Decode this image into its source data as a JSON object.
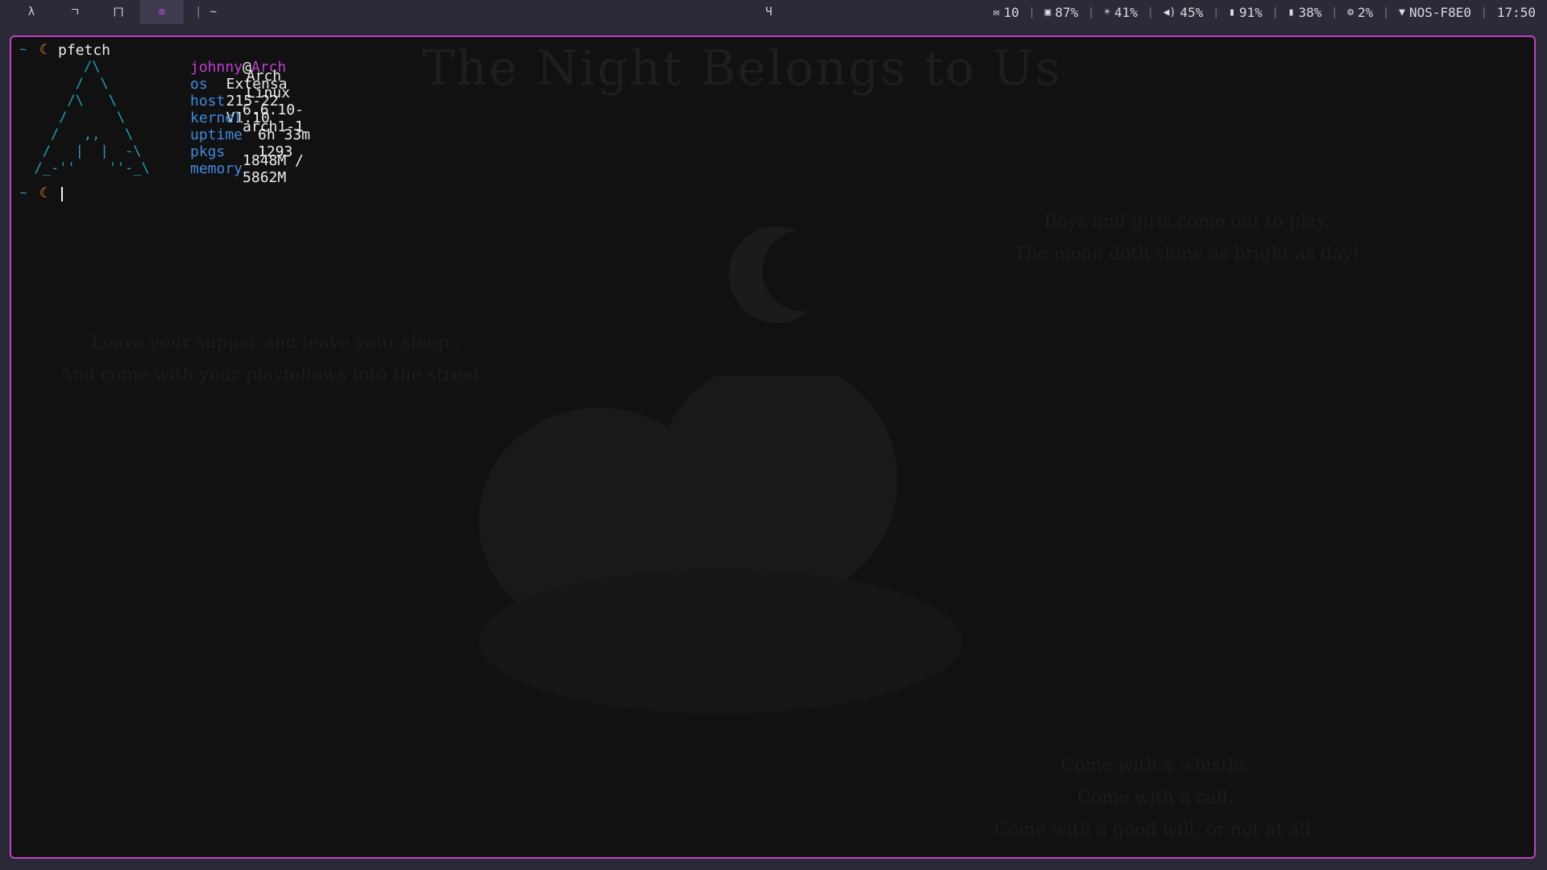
{
  "topbar": {
    "workspaces": [
      {
        "label": "λ",
        "active": false
      },
      {
        "label": "ㄱ",
        "active": false
      },
      {
        "label": "ㄇ",
        "active": false
      },
      {
        "label": "≋",
        "active": true
      }
    ],
    "separator": "|",
    "workspace_extra": "~",
    "center_icon": "Ч",
    "status": [
      {
        "icon": "mail-icon",
        "glyph": "✉",
        "value": "10"
      },
      {
        "icon": "disk-icon",
        "glyph": "▣",
        "value": "87%"
      },
      {
        "icon": "brightness-icon",
        "glyph": "☀",
        "value": "41%"
      },
      {
        "icon": "volume-icon",
        "glyph": "🔈",
        "value": "45%"
      },
      {
        "icon": "mouse-battery-icon",
        "glyph": "▮",
        "value": "91%"
      },
      {
        "icon": "battery-icon",
        "glyph": "▮",
        "value": "38%"
      },
      {
        "icon": "cpu-icon",
        "glyph": "⚙",
        "value": "2%"
      },
      {
        "icon": "wifi-icon",
        "glyph": "▼",
        "value": "NOS-F8E0"
      }
    ],
    "clock": "17:50"
  },
  "wallpaper": {
    "title": "The Night Belongs to Us",
    "verse_right": [
      "Boys and girls,come out to play,",
      "The moon doth shine as bright as day!"
    ],
    "verse_left": [
      "Leave your supper and leave your sleep ,",
      "And come with your playfellows into the street ."
    ],
    "verse_bottom": [
      "Come with a whistle,",
      "Come with a call,",
      "Come with a good will, or not at all."
    ]
  },
  "terminal": {
    "prompt_tilde": "~",
    "prompt_icon": "☾",
    "command": "pfetch",
    "logo": "        /\\\n       /  \\\n      /\\   \\\n     /      \\\n    /   ,,   \\\n   /   |  |  -\\\n  /_-''    ''-_\\",
    "user": "johnny",
    "at": "@",
    "host": "Arch",
    "info": [
      {
        "key": "os",
        "value": "Arch Linux"
      },
      {
        "key": "host",
        "value": "Extensa 215-22 V1.10"
      },
      {
        "key": "kernel",
        "value": "6.6.10-arch1-1"
      },
      {
        "key": "uptime",
        "value": "6h 33m"
      },
      {
        "key": "pkgs",
        "value": "1293"
      },
      {
        "key": "memory",
        "value": "1848M / 5862M"
      }
    ]
  },
  "colors": {
    "border": "#c23fc9",
    "accent_user": "#c03fd0",
    "info_key": "#3c8be0",
    "logo": "#1aa2b9",
    "prompt_moon": "#e88a2e"
  }
}
